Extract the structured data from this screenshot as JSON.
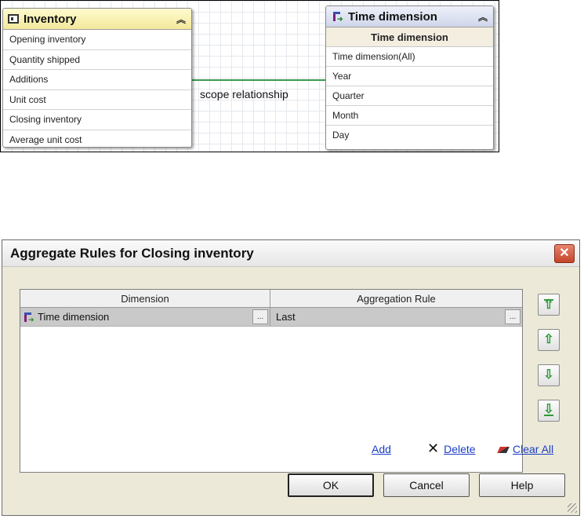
{
  "diagram": {
    "connector_label": "scope relationship",
    "inventory": {
      "title": "Inventory",
      "attributes": [
        "Opening inventory",
        "Quantity shipped",
        "Additions",
        "Unit cost",
        "Closing inventory",
        "Average unit cost"
      ]
    },
    "time": {
      "title": "Time dimension",
      "subtitle": "Time dimension",
      "attributes": [
        "Time dimension(All)",
        "Year",
        "Quarter",
        "Month",
        "Day"
      ]
    }
  },
  "dialog": {
    "title": "Aggregate Rules for Closing inventory",
    "close_label": "✕",
    "columns": [
      "Dimension",
      "Aggregation Rule"
    ],
    "rows": [
      {
        "dimension": "Time dimension",
        "rule": "Last"
      }
    ],
    "ellipsis_label": "...",
    "links": {
      "add": "Add",
      "delete": "Delete",
      "clear_all": "Clear All"
    },
    "buttons": {
      "ok": "OK",
      "cancel": "Cancel",
      "help": "Help"
    }
  },
  "colors": {
    "connector": "#3a9a4c",
    "inventory_header": "#f3e89a",
    "time_header": "#cfd6ea",
    "dialog_bg": "#ece9d8",
    "link": "#1a3fc8",
    "arrow_green": "#2e9a3a",
    "close_red": "#c4452a"
  }
}
